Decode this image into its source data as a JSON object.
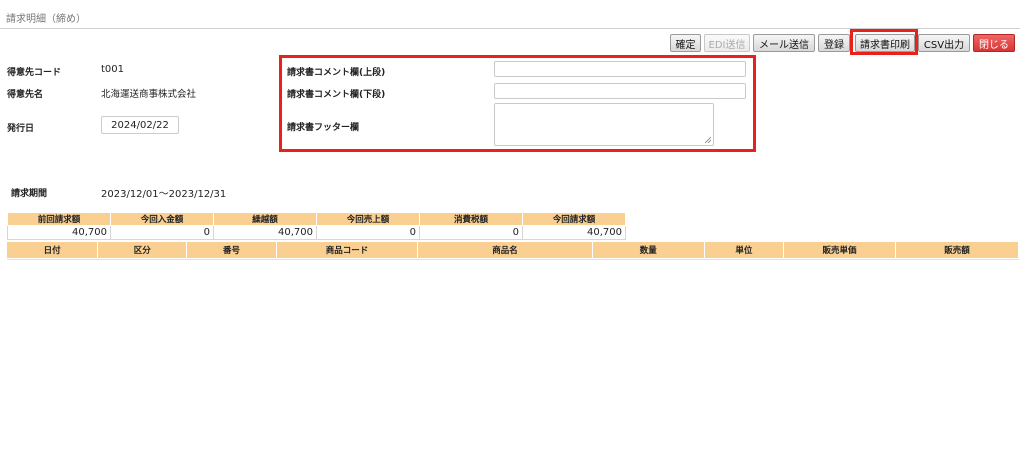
{
  "page": {
    "title": "請求明細（締め）"
  },
  "toolbar": {
    "confirm": "確定",
    "edi_send": "EDI送信",
    "mail_send": "メール送信",
    "register": "登録",
    "print_invoice": "請求書印刷",
    "csv_output": "CSV出力",
    "close": "閉じる"
  },
  "customer": {
    "code_label": "得意先コード",
    "code_value": "t001",
    "name_label": "得意先名",
    "name_value": "北海運送商事株式会社",
    "issue_label": "発行日",
    "issue_value": "2024/02/22"
  },
  "comments": {
    "upper_label": "請求書コメント欄(上段)",
    "lower_label": "請求書コメント欄(下段)",
    "footer_label": "請求書フッター欄",
    "upper_value": "",
    "lower_value": "",
    "footer_value": ""
  },
  "period": {
    "label": "請求期間",
    "value": "2023/12/01〜2023/12/31"
  },
  "summary": {
    "headers": [
      "前回請求額",
      "今回入金額",
      "繰越額",
      "今回売上額",
      "消費税額",
      "今回請求額"
    ],
    "values": [
      "40,700",
      "0",
      "40,700",
      "0",
      "0",
      "40,700"
    ]
  },
  "detail": {
    "headers": [
      "日付",
      "区分",
      "番号",
      "商品コード",
      "商品名",
      "数量",
      "単位",
      "販売単価",
      "販売額"
    ]
  },
  "colors": {
    "header_bg": "#f9cf92",
    "highlight": "#e8211c",
    "close_button": "#d93535"
  }
}
